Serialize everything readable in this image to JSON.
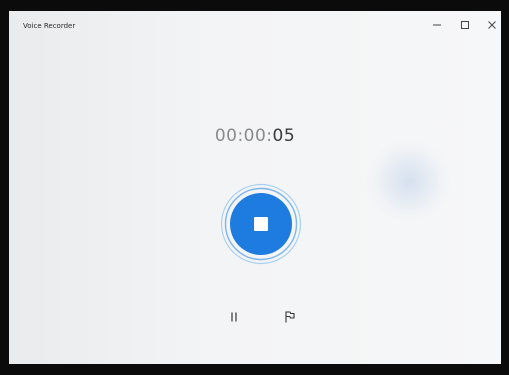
{
  "window": {
    "title": "Voice Recorder",
    "controls": {
      "minimize_icon": "minimize-icon",
      "maximize_icon": "maximize-icon",
      "close_icon": "close-icon"
    }
  },
  "recorder": {
    "timer_dim": "00:00:",
    "timer_active": "05",
    "state": "recording",
    "accent_color": "#1e7be0",
    "ring_color": "#8ec2f0",
    "stop_icon": "stop-icon",
    "pause_icon": "pause-icon",
    "flag_icon": "flag-icon"
  }
}
